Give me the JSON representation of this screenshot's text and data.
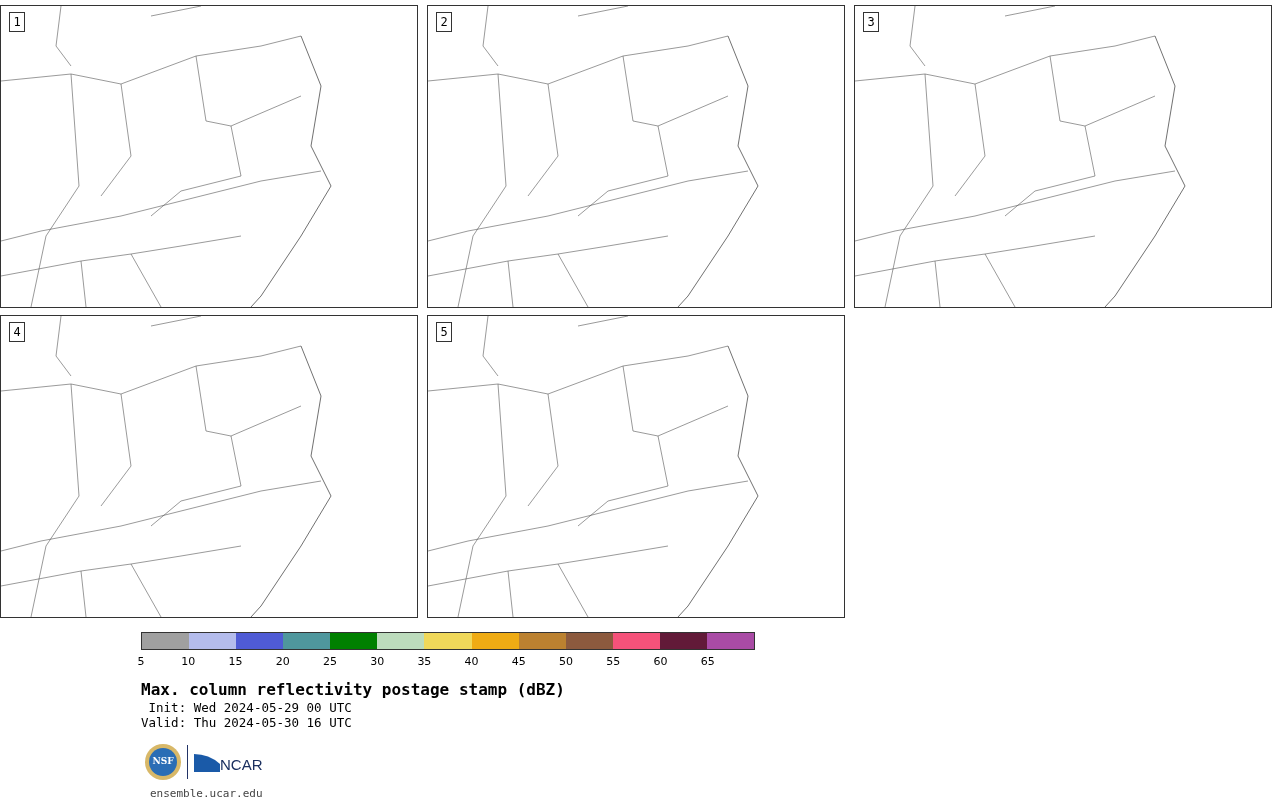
{
  "panels": [
    {
      "label": "1"
    },
    {
      "label": "2"
    },
    {
      "label": "3"
    },
    {
      "label": "4"
    },
    {
      "label": "5"
    }
  ],
  "legend": {
    "bins": [
      {
        "color": "#a0a0a0"
      },
      {
        "color": "#b4bcec"
      },
      {
        "color": "#4f5bd5"
      },
      {
        "color": "#4f979d"
      },
      {
        "color": "#008000"
      },
      {
        "color": "#bddcbd"
      },
      {
        "color": "#f0d85a"
      },
      {
        "color": "#efab14"
      },
      {
        "color": "#bb8130"
      },
      {
        "color": "#8c5a3e"
      },
      {
        "color": "#f5527a"
      },
      {
        "color": "#621a38"
      },
      {
        "color": "#a94ba5"
      }
    ],
    "ticks": [
      "5",
      "10",
      "15",
      "20",
      "25",
      "30",
      "35",
      "40",
      "45",
      "50",
      "55",
      "60",
      "65"
    ]
  },
  "title": "Max. column reflectivity postage stamp (dBZ)",
  "init": " Init: Wed 2024-05-29 00 UTC",
  "valid": "Valid: Thu 2024-05-30 16 UTC",
  "logo": {
    "nsf": "NSF",
    "ncar": "NCAR"
  },
  "url": "ensemble.ucar.edu"
}
